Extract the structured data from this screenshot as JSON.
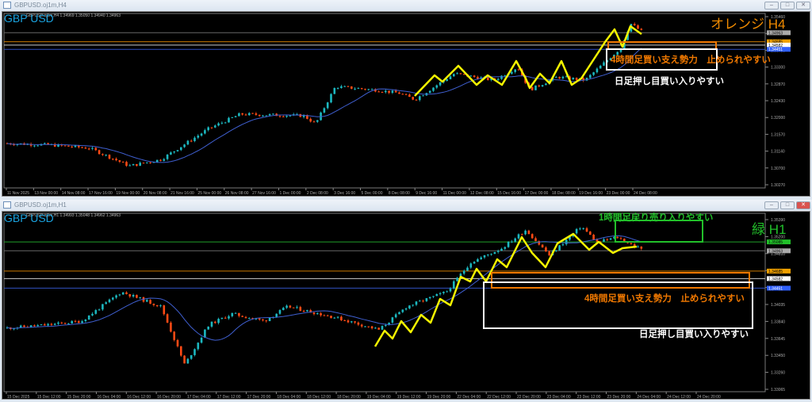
{
  "colors": {
    "bull": "#1cb8c0",
    "bear": "#ff4a14",
    "ma": "#3f5fd0",
    "zig": "#f5f500",
    "orange": "#f07800",
    "green": "#22c02a",
    "white": "#ffffff",
    "axis": "#aaaaaa"
  },
  "top": {
    "title": "GBPUSD.oj1m,H4",
    "symbol_label": "GBP USD",
    "ohlc": "GBPUSD.oj1m,H4 1.34969 1.35050 1.34940 1.34963",
    "timeframe_label": "オレンジ H4",
    "annotation_orange": "4時間足買い支え勢力　止められやすい",
    "annotation_white": "日足押し目買い入りやすい",
    "price_range": [
      1.3027,
      1.3546
    ],
    "price_ticks": [
      "1.35460",
      "1.34170",
      "1.33730",
      "1.33300",
      "1.32870",
      "1.32430",
      "1.32000",
      "1.31570",
      "1.31140",
      "1.30700",
      "1.30270"
    ],
    "price_markers": [
      {
        "value": "1.34963",
        "price": 1.34963,
        "kind": "gray"
      },
      {
        "value": "1.34685",
        "price": 1.34685,
        "kind": "orange"
      },
      {
        "value": "1.34582",
        "price": 1.34582,
        "kind": "white"
      },
      {
        "value": "1.34451",
        "price": 1.34451,
        "kind": "blue"
      }
    ],
    "time_labels": [
      "11 Nov 2025",
      "13 Nov 00:00",
      "14 Nov 08:00",
      "17 Nov 16:00",
      "19 Nov 00:00",
      "20 Nov 08:00",
      "21 Nov 16:00",
      "25 Nov 00:00",
      "26 Nov 08:00",
      "27 Nov 16:00",
      "1 Dec 00:00",
      "2 Dec 08:00",
      "3 Dec 16:00",
      "5 Dec 00:00",
      "8 Dec 08:00",
      "9 Dec 16:00",
      "11 Dec 00:00",
      "12 Dec 08:00",
      "15 Dec 16:00",
      "17 Dec 00:00",
      "18 Dec 08:00",
      "19 Dec 16:00",
      "23 Dec 00:00",
      "24 Dec 08:00"
    ],
    "price_path": [
      [
        0,
        1.3155
      ],
      [
        60,
        1.315
      ],
      [
        110,
        1.314
      ],
      [
        160,
        1.3085
      ],
      [
        200,
        1.3105
      ],
      [
        260,
        1.32
      ],
      [
        300,
        1.3245
      ],
      [
        380,
        1.324
      ],
      [
        395,
        1.3215
      ],
      [
        420,
        1.333
      ],
      [
        470,
        1.332
      ],
      [
        500,
        1.331
      ],
      [
        520,
        1.329
      ],
      [
        570,
        1.337
      ],
      [
        620,
        1.335
      ],
      [
        650,
        1.339
      ],
      [
        665,
        1.332
      ],
      [
        700,
        1.336
      ],
      [
        735,
        1.335
      ],
      [
        780,
        1.345
      ],
      [
        792,
        1.3525
      ],
      [
        808,
        1.3497
      ]
    ]
  },
  "bottom": {
    "title": "GBPUSD.oj1m,H1",
    "symbol_label": "GBP USD",
    "ohlc": "GBPUSD.oj1m,H1 1.34993 1.35048 1.34962 1.34963",
    "timeframe_label": "緑 H1",
    "annotation_green": "1時間足戻り売り入りやすい",
    "annotation_orange": "4時間足買い支え勢力　止められやすい",
    "annotation_white": "日足押し目買い入りやすい",
    "price_range": [
      1.33065,
      1.3539
    ],
    "price_ticks": [
      "1.35390",
      "1.35200",
      "1.34810",
      "1.34420",
      "1.34230",
      "1.34035",
      "1.33840",
      "1.33645",
      "1.33450",
      "1.33260",
      "1.33065"
    ],
    "price_markers": [
      {
        "value": "1.35085",
        "price": 1.35085,
        "kind": "green"
      },
      {
        "value": "1.34963",
        "price": 1.34963,
        "kind": "gray"
      },
      {
        "value": "1.34685",
        "price": 1.34685,
        "kind": "orange"
      },
      {
        "value": "1.34582",
        "price": 1.34582,
        "kind": "white"
      },
      {
        "value": "1.34451",
        "price": 1.34451,
        "kind": "blue"
      }
    ],
    "time_labels": [
      "15 Dec 2025",
      "15 Dec 12:00",
      "15 Dec 20:00",
      "16 Dec 04:00",
      "16 Dec 12:00",
      "16 Dec 20:00",
      "17 Dec 04:00",
      "17 Dec 12:00",
      "17 Dec 20:00",
      "18 Dec 04:00",
      "18 Dec 12:00",
      "18 Dec 20:00",
      "19 Dec 04:00",
      "19 Dec 12:00",
      "19 Dec 20:00",
      "22 Dec 04:00",
      "22 Dec 12:00",
      "22 Dec 20:00",
      "23 Dec 04:00",
      "23 Dec 12:00",
      "23 Dec 20:00",
      "24 Dec 04:00",
      "24 Dec 12:00",
      "24 Dec 20:00"
    ],
    "price_path": [
      [
        0,
        1.339
      ],
      [
        60,
        1.3395
      ],
      [
        100,
        1.34
      ],
      [
        150,
        1.344
      ],
      [
        200,
        1.342
      ],
      [
        230,
        1.334
      ],
      [
        260,
        1.3395
      ],
      [
        290,
        1.341
      ],
      [
        330,
        1.34
      ],
      [
        360,
        1.342
      ],
      [
        420,
        1.3405
      ],
      [
        475,
        1.3388
      ],
      [
        510,
        1.342
      ],
      [
        560,
        1.344
      ],
      [
        590,
        1.348
      ],
      [
        630,
        1.35
      ],
      [
        660,
        1.3525
      ],
      [
        690,
        1.349
      ],
      [
        730,
        1.353
      ],
      [
        750,
        1.3508
      ],
      [
        775,
        1.3515
      ],
      [
        808,
        1.3497
      ]
    ]
  }
}
